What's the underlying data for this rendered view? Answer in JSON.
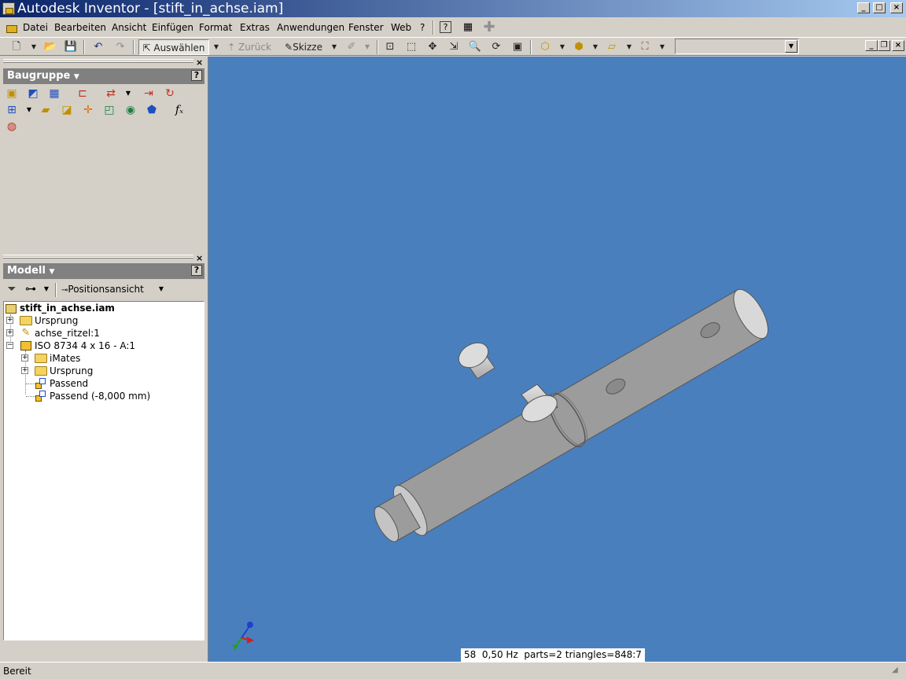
{
  "window": {
    "title": "Autodesk Inventor - [stift_in_achse.iam]",
    "controls": {
      "minimize": "_",
      "maximize": "□",
      "close": "×"
    }
  },
  "menubar": {
    "items": [
      "Datei",
      "Bearbeiten",
      "Ansicht",
      "Einfügen",
      "Format",
      "Extras",
      "Anwendungen",
      "Fenster",
      "Web",
      "?"
    ],
    "doc_controls": {
      "minimize": "_",
      "restore": "❐",
      "close": "×"
    }
  },
  "toolbar": {
    "select_label": "Auswählen",
    "back_label": "Zurück",
    "sketch_label": "Skizze",
    "style_combo_value": ""
  },
  "assembly_panel": {
    "title": "Baugruppe",
    "help": "?"
  },
  "model_panel": {
    "title": "Modell",
    "help": "?",
    "view_label": "Positionsansicht",
    "tree": [
      {
        "label": "stift_in_achse.iam",
        "bold": true
      },
      {
        "label": "Ursprung"
      },
      {
        "label": "achse_ritzel:1"
      },
      {
        "label": "ISO 8734 4 x 16 - A:1"
      },
      {
        "label": "iMates"
      },
      {
        "label": "Ursprung"
      },
      {
        "label": "Passend"
      },
      {
        "label": "Passend (-8,000 mm)"
      }
    ]
  },
  "viewport": {
    "background_color": "#4a7fbd",
    "stats": "58  0,50 Hz  parts=2 triangles=848:7"
  },
  "status": {
    "text": "Bereit"
  }
}
